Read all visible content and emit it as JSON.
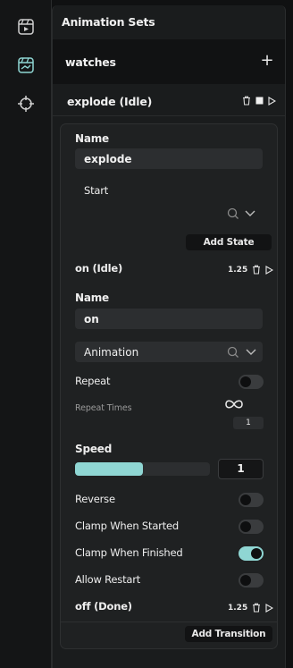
{
  "rail": {
    "items": [
      "play-window-icon",
      "animation-icon",
      "crosshair-icon"
    ]
  },
  "panel": {
    "title": "Animation Sets",
    "set_name": "watches",
    "add_label": "+",
    "sub_item": "explode (Idle)"
  },
  "card": {
    "name_label": "Name",
    "name_value": "explode",
    "start_label": "Start",
    "add_state": "Add State",
    "state_on": {
      "title": "on (Idle)",
      "duration": "1.25"
    },
    "state_name_label": "Name",
    "state_name_value": "on",
    "animation_value": "Animation",
    "repeat_label": "Repeat",
    "repeat_times_label": "Repeat Times",
    "repeat_times_value": "1",
    "speed_label": "Speed",
    "speed_value": "1",
    "speed_fill": 0.5,
    "reverse_label": "Reverse",
    "clamp_started_label": "Clamp When Started",
    "clamp_finished_label": "Clamp When Finished",
    "allow_restart_label": "Allow Restart",
    "state_off": {
      "title": "off (Done)",
      "duration": "1.25"
    },
    "add_transition": "Add Transition",
    "toggles": {
      "repeat": false,
      "reverse": false,
      "clamp_started": false,
      "clamp_finished": true,
      "allow_restart": false
    }
  },
  "colors": {
    "accent": "#8fd6d3",
    "bg": "#101112",
    "field": "#2c2e30"
  }
}
